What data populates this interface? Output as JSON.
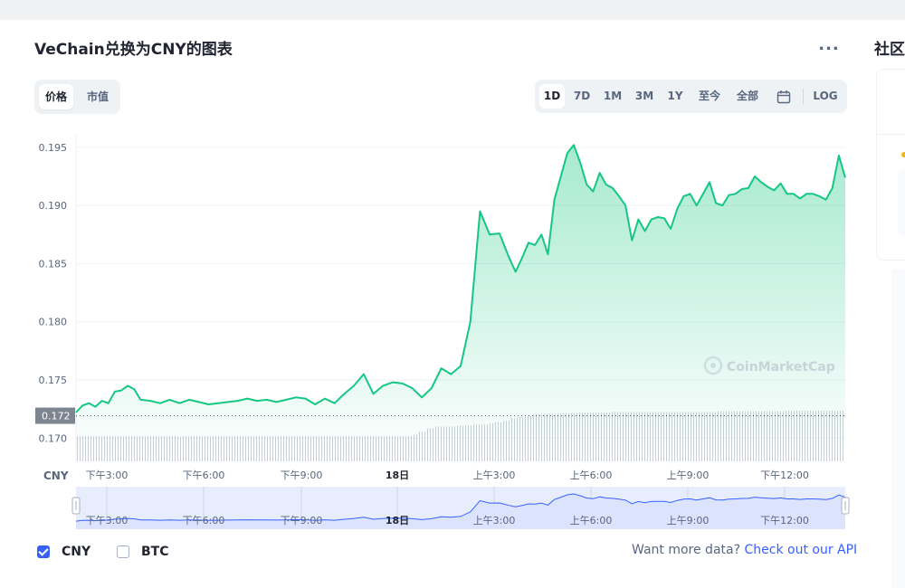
{
  "title": "VeChain兑换为CNY的图表",
  "more_menu": "...",
  "side_title": "社区",
  "tabs": [
    {
      "label": "价格",
      "active": true
    },
    {
      "label": "市值",
      "active": false
    }
  ],
  "ranges": [
    {
      "label": "1D",
      "active": true
    },
    {
      "label": "7D",
      "active": false
    },
    {
      "label": "1M",
      "active": false
    },
    {
      "label": "3M",
      "active": false
    },
    {
      "label": "1Y",
      "active": false
    },
    {
      "label": "至今",
      "active": false
    },
    {
      "label": "全部",
      "active": false
    },
    {
      "label": "LOG",
      "active": false
    }
  ],
  "calendar_icon": "calendar-icon",
  "legend": [
    {
      "label": "CNY",
      "checked": true
    },
    {
      "label": "BTC",
      "checked": false
    }
  ],
  "api_prompt": "Want more data?",
  "api_link": "Check out our API",
  "colors": {
    "line": "#16c784",
    "area_top": "#16c784",
    "accent": "#3861fb",
    "navigator_fill": "#dbe3fd",
    "navigator_line": "#3861fb",
    "volume": "#c9ced6",
    "current_price_tag": "#7d8591"
  },
  "chart_data": {
    "type": "area",
    "currency_label": "CNY",
    "current_price_label": "0.172",
    "watermark": "CoinMarketCap",
    "ylim": [
      0.168,
      0.196
    ],
    "yticks": [
      0.195,
      0.19,
      0.185,
      0.18,
      0.175,
      0.17
    ],
    "ytick_labels": [
      "0.195",
      "0.190",
      "0.185",
      "0.180",
      "0.175",
      "0.170"
    ],
    "xlabels": [
      "下午3:00",
      "下午6:00",
      "下午9:00",
      "18日",
      "上午3:00",
      "上午6:00",
      "上午9:00",
      "下午12:00"
    ],
    "grid": true,
    "series": [
      {
        "x": [
          0,
          0.2,
          0.4,
          0.6,
          0.8,
          1.0,
          1.2,
          1.4,
          1.6,
          1.8,
          2.0,
          2.3,
          2.6,
          2.9,
          3.2,
          3.5,
          3.8,
          4.1,
          4.4,
          4.7,
          5.0,
          5.3,
          5.6,
          5.9,
          6.2,
          6.5,
          6.8,
          7.1,
          7.4,
          7.7,
          8.0,
          8.3,
          8.6,
          8.9,
          9.2,
          9.5,
          9.8,
          10.1,
          10.4,
          10.7,
          11.0,
          11.3,
          11.6,
          11.9,
          12.2,
          12.5,
          12.8,
          13.1,
          13.4,
          13.6,
          13.8,
          14.0,
          14.2,
          14.4,
          14.6,
          14.8,
          15.0,
          15.2,
          15.4,
          15.6,
          15.8,
          16.0,
          16.2,
          16.4,
          16.6,
          16.8,
          17.0,
          17.2,
          17.4,
          17.6,
          17.8,
          18.0,
          18.2,
          18.4,
          18.6,
          18.8,
          19.0,
          19.2,
          19.4,
          19.6,
          19.8,
          20.0,
          20.2,
          20.4,
          20.6,
          20.8,
          21.0,
          21.2,
          21.4,
          21.6,
          21.8,
          22.0,
          22.2,
          22.4,
          22.6,
          22.8,
          23.0,
          23.2,
          23.4,
          23.6,
          23.8
        ],
        "values": [
          0.1722,
          0.1728,
          0.173,
          0.1727,
          0.1732,
          0.173,
          0.174,
          0.1741,
          0.1745,
          0.1742,
          0.1733,
          0.1732,
          0.173,
          0.1733,
          0.173,
          0.1733,
          0.1731,
          0.1729,
          0.173,
          0.1731,
          0.1732,
          0.1734,
          0.1732,
          0.1733,
          0.1731,
          0.1733,
          0.1735,
          0.1734,
          0.1729,
          0.1734,
          0.173,
          0.1738,
          0.1745,
          0.1755,
          0.1738,
          0.1745,
          0.1748,
          0.1747,
          0.1743,
          0.1735,
          0.1743,
          0.176,
          0.1755,
          0.1762,
          0.18,
          0.1895,
          0.1875,
          0.1876,
          0.1855,
          0.1843,
          0.1855,
          0.1868,
          0.1866,
          0.1875,
          0.1858,
          0.1905,
          0.1925,
          0.1945,
          0.1952,
          0.1937,
          0.1918,
          0.1912,
          0.1928,
          0.1918,
          0.1915,
          0.1908,
          0.19,
          0.187,
          0.1888,
          0.1878,
          0.1888,
          0.189,
          0.1889,
          0.188,
          0.1897,
          0.1908,
          0.191,
          0.19,
          0.191,
          0.192,
          0.1902,
          0.19,
          0.1909,
          0.191,
          0.1914,
          0.1915,
          0.1925,
          0.192,
          0.1916,
          0.1913,
          0.1919,
          0.191,
          0.191,
          0.1906,
          0.191,
          0.191,
          0.1908,
          0.1905,
          0.1915,
          0.1943,
          0.1924
        ]
      }
    ],
    "volume": [
      0.4,
      0.4,
      0.4,
      0.4,
      0.4,
      0.4,
      0.4,
      0.4,
      0.4,
      0.4,
      0.4,
      0.4,
      0.4,
      0.39,
      0.4,
      0.4,
      0.4,
      0.4,
      0.4,
      0.4,
      0.4,
      0.4,
      0.4,
      0.4,
      0.4,
      0.4,
      0.4,
      0.4,
      0.4,
      0.4,
      0.4,
      0.4,
      0.4,
      0.4,
      0.4,
      0.4,
      0.4,
      0.4,
      0.4,
      0.4,
      0.4,
      0.4,
      0.4,
      0.4,
      0.42,
      0.47,
      0.52,
      0.55,
      0.55,
      0.55,
      0.56,
      0.57,
      0.58,
      0.58,
      0.6,
      0.62,
      0.64,
      0.68,
      0.7,
      0.72,
      0.74,
      0.75,
      0.75,
      0.76,
      0.76,
      0.76,
      0.77,
      0.77,
      0.77,
      0.77,
      0.78,
      0.78,
      0.78,
      0.78,
      0.78,
      0.78,
      0.78,
      0.78,
      0.78,
      0.78,
      0.78,
      0.78,
      0.78,
      0.78,
      0.79,
      0.79,
      0.79,
      0.79,
      0.79,
      0.79,
      0.79,
      0.79,
      0.79,
      0.8,
      0.8,
      0.8,
      0.8,
      0.8,
      0.8,
      0.8,
      0.8
    ]
  }
}
